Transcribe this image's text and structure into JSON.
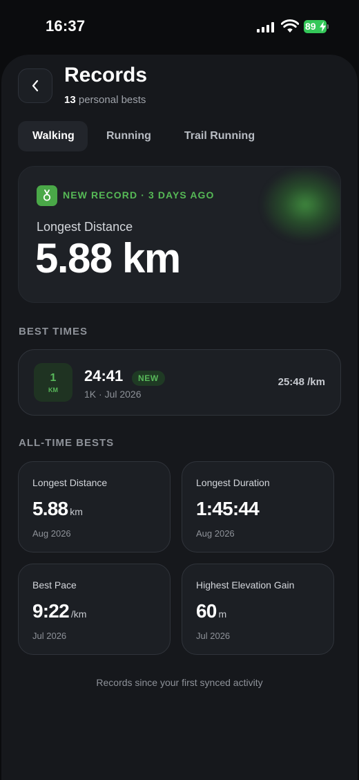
{
  "status_bar": {
    "time": "16:37",
    "battery": "89"
  },
  "header": {
    "title": "Records",
    "count": "13",
    "count_label": "personal bests"
  },
  "tabs": [
    {
      "label": "Walking",
      "active": true
    },
    {
      "label": "Running",
      "active": false
    },
    {
      "label": "Trail Running",
      "active": false
    }
  ],
  "hero": {
    "badge": "NEW RECORD · 3 DAYS AGO",
    "label": "Longest Distance",
    "value": "5.88 km",
    "accent": "#4aa848"
  },
  "best_times": {
    "title": "BEST TIMES",
    "items": [
      {
        "distance": "1",
        "unit": "KM",
        "time": "24:41",
        "tag": "NEW",
        "meta": "1K · Jul 2026",
        "pace": "25:48 /km"
      }
    ]
  },
  "all_time": {
    "title": "ALL-TIME BESTS",
    "items": [
      {
        "label": "Longest Distance",
        "value": "5.88",
        "unit": "km",
        "date": "Aug 2026"
      },
      {
        "label": "Longest Duration",
        "value": "1:45:44",
        "unit": "",
        "date": "Aug 2026"
      },
      {
        "label": "Best Pace",
        "value": "9:22",
        "unit": "/km",
        "date": "Jul 2026"
      },
      {
        "label": "Highest Elevation Gain",
        "value": "60",
        "unit": "m",
        "date": "Jul 2026"
      }
    ]
  },
  "footer": "Records since your first synced activity",
  "icons": [
    "signal-icon",
    "wifi-icon",
    "battery-icon",
    "back-chevron-icon",
    "medal-icon"
  ]
}
